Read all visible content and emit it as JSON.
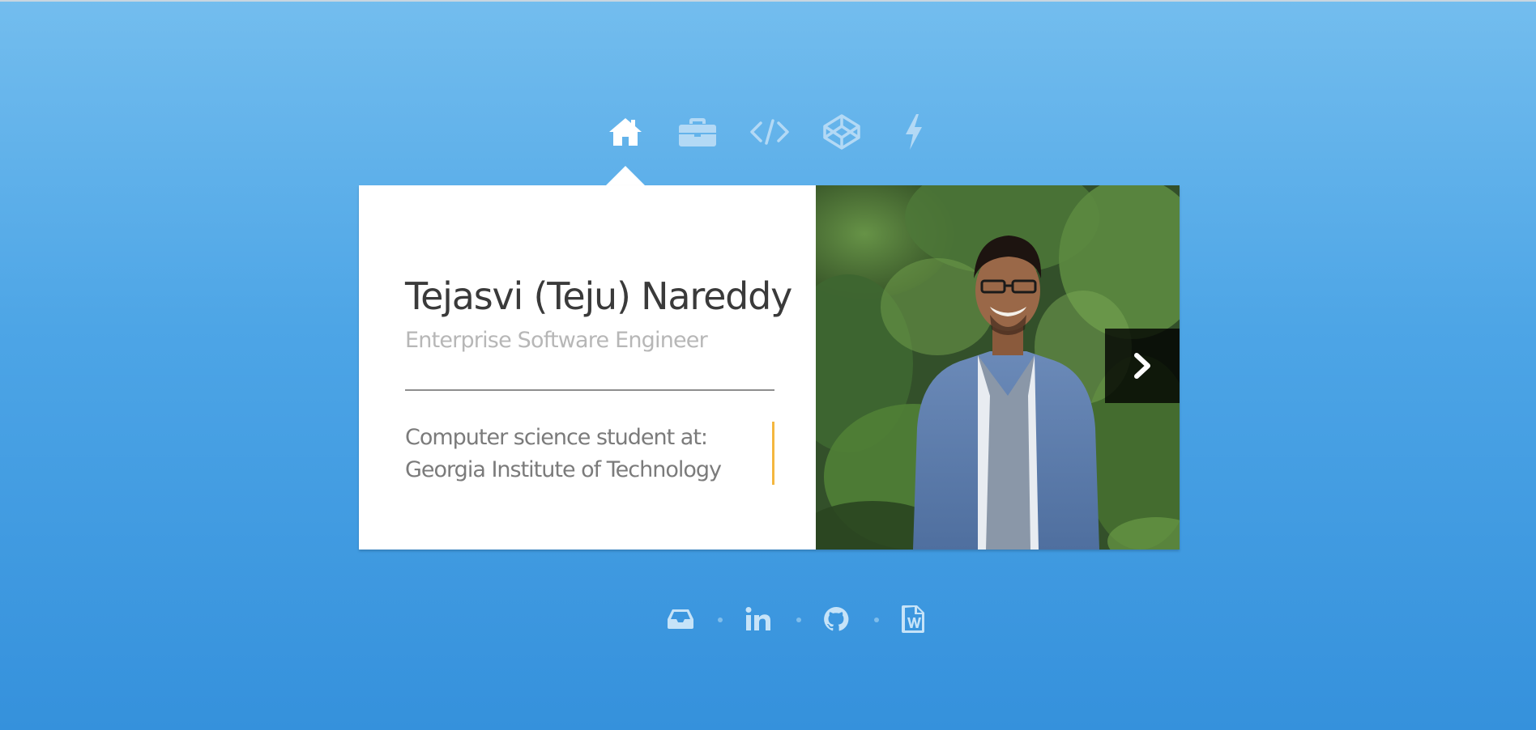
{
  "nav": {
    "items": [
      {
        "icon": "home-icon",
        "active": true
      },
      {
        "icon": "briefcase-icon",
        "active": false
      },
      {
        "icon": "code-icon",
        "active": false
      },
      {
        "icon": "codepen-icon",
        "active": false
      },
      {
        "icon": "lightning-icon",
        "active": false
      }
    ]
  },
  "profile": {
    "name": "Tejasvi (Teju) Nareddy",
    "title": "Enterprise Software Engineer",
    "bio_line1": "Computer science student at:",
    "bio_line2": "Georgia Institute of Technology"
  },
  "photo": {
    "next_icon": "chevron-right-icon"
  },
  "social": {
    "items": [
      {
        "icon": "inbox-icon"
      },
      {
        "icon": "linkedin-icon"
      },
      {
        "icon": "github-icon"
      },
      {
        "icon": "word-document-icon"
      }
    ]
  },
  "colors": {
    "background_top": "#73bdee",
    "background_bottom": "#3591dc",
    "accent": "#f4b73f",
    "card": "#ffffff"
  }
}
